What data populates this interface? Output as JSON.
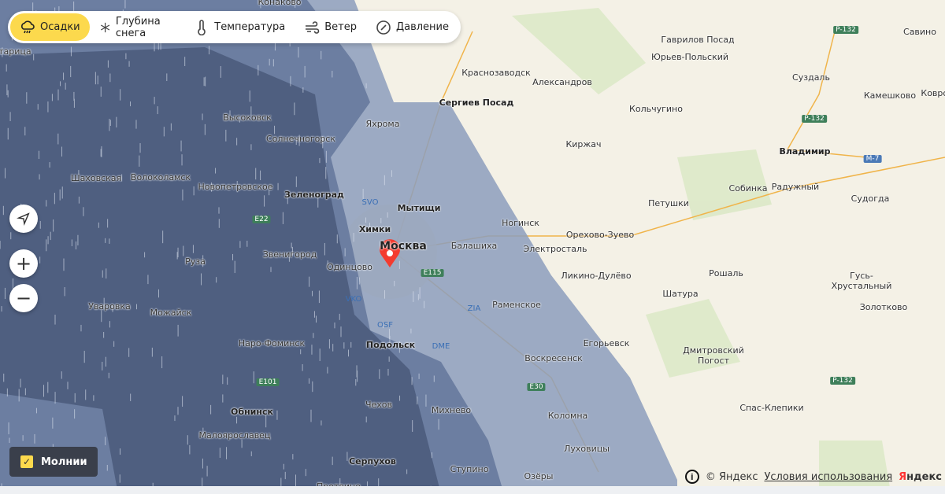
{
  "toolbar": {
    "items": [
      {
        "label": "Осадки",
        "icon": "rain-cloud-icon",
        "active": true
      },
      {
        "label": "Глубина снега",
        "icon": "snowflake-icon"
      },
      {
        "label": "Температура",
        "icon": "thermometer-icon"
      },
      {
        "label": "Ветер",
        "icon": "wind-icon"
      },
      {
        "label": "Давление",
        "icon": "pressure-gauge-icon"
      }
    ]
  },
  "controls": {
    "zoom_in": "+",
    "zoom_out": "−"
  },
  "lightning": {
    "label": "Молнии",
    "checked": true
  },
  "footer": {
    "copyright": "© Яндекс",
    "terms": "Условия использования",
    "logo_first": "Я",
    "logo_rest": "ндекс"
  },
  "cities": [
    "Конаково",
    "Гаврилов Посад",
    "Савино",
    "Юрьев-Польский",
    "Краснозаводск",
    "Александров",
    "Суздаль",
    "Сергиев Посад",
    "Кольчугино",
    "Камешково",
    "Ковров",
    "Высоковск",
    "Солнечногорск",
    "Яхрома",
    "Киржач",
    "Владимир",
    "Шаховская",
    "Волоколамск",
    "Новопетровское",
    "Зеленоград",
    "Собинка",
    "Радужный",
    "Судогда",
    "Мытищи",
    "Петушки",
    "Химки",
    "Ногинск",
    "Москва",
    "Балашиха",
    "Электросталь",
    "Орехово-Зуево",
    "Руза",
    "Звенигород",
    "Одинцово",
    "Ликино-Дулёво",
    "Рошаль",
    "Гусь-Хрустальный",
    "Уваровка",
    "Можайск",
    "Шатура",
    "Раменское",
    "Золотково",
    "Наро-Фоминск",
    "Подольск",
    "Егорьевск",
    "Дмитровский Погост",
    "Воскресенск",
    "Обнинск",
    "Чехов",
    "Михнево",
    "Коломна",
    "Спас-Клепики",
    "Малоярославец",
    "Луховицы",
    "Серпухов",
    "Ступино",
    "Озёры",
    "Протвино",
    "Старица"
  ],
  "roads": [
    "E22",
    "E115",
    "E101",
    "E30",
    "P-132",
    "P-132",
    "M-7",
    "P-132"
  ],
  "airports": [
    "SVO",
    "VKO",
    "ZIA",
    "OSF",
    "DME"
  ],
  "colors": {
    "active": "#fcd94d",
    "marker": "#f33b2f"
  }
}
